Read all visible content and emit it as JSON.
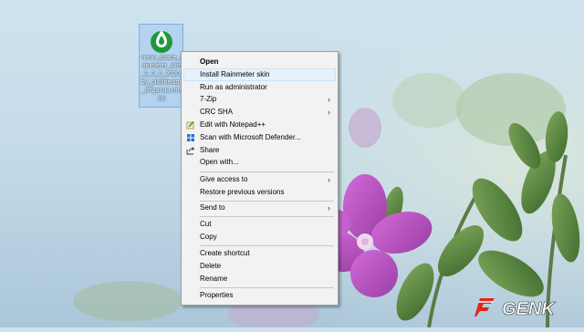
{
  "desktop_icon": {
    "label": "neon_space_rainmeter_skin_3_0_0_2020_by_pixilldesign_d7ganua.rmskin"
  },
  "context_menu": {
    "items": [
      {
        "label": "Open"
      },
      {
        "label": "Install Rainmeter skin"
      },
      {
        "label": "Run as administrator"
      },
      {
        "label": "7-Zip"
      },
      {
        "label": "CRC SHA"
      },
      {
        "label": "Edit with Notepad++"
      },
      {
        "label": "Scan with Microsoft Defender..."
      },
      {
        "label": "Share"
      },
      {
        "label": "Open with..."
      },
      {
        "label": "Give access to"
      },
      {
        "label": "Restore previous versions"
      },
      {
        "label": "Send to"
      },
      {
        "label": "Cut"
      },
      {
        "label": "Copy"
      },
      {
        "label": "Create shortcut"
      },
      {
        "label": "Delete"
      },
      {
        "label": "Rename"
      },
      {
        "label": "Properties"
      }
    ],
    "submenu_arrow": "›"
  },
  "watermark": {
    "text": "GENK"
  },
  "colors": {
    "accent_hover": "#e5f1fb",
    "rainmeter_green": "#1e9a3c",
    "watermark_red": "#e0261b"
  }
}
